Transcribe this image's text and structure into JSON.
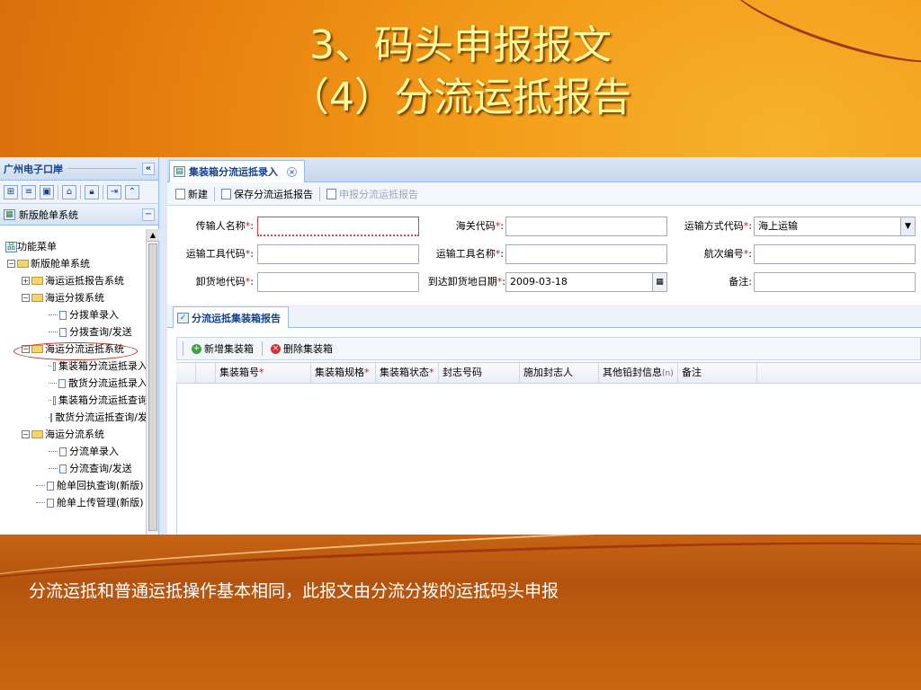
{
  "slide": {
    "title_line1": "3、码头申报报文",
    "title_line2": "（4）分流运抵报告",
    "caption": "分流运抵和普通运抵操作基本相同，此报文由分流分拨的运抵码头申报"
  },
  "sidebar": {
    "header_title": "广州电子口岸",
    "collapse_glyph": "«",
    "panel_title": "新版舱单系统",
    "tree": [
      {
        "label": "功能菜单"
      },
      {
        "label": "新版舱单系统"
      },
      {
        "label": "海运运抵报告系统"
      },
      {
        "label": "海运分拨系统"
      },
      {
        "label": "分拨单录入"
      },
      {
        "label": "分拨查询/发送"
      },
      {
        "label": "海运分流运抵系统"
      },
      {
        "label": "集装箱分流运抵录入"
      },
      {
        "label": "散货分流运抵录入"
      },
      {
        "label": "集装箱分流运抵查询"
      },
      {
        "label": "散货分流运抵查询/发"
      },
      {
        "label": "海运分流系统"
      },
      {
        "label": "分流单录入"
      },
      {
        "label": "分流查询/发送"
      },
      {
        "label": "舱单回执查询(新版)"
      },
      {
        "label": "舱单上传管理(新版)"
      }
    ]
  },
  "main": {
    "tab_title": "集装箱分流运抵录入",
    "toolbar": {
      "new_label": "新建",
      "save_label": "保存分流运抵报告",
      "declare_label": "申报分流运抵报告"
    },
    "form": {
      "sender_name_label": "传输人名称",
      "customs_code_label": "海关代码",
      "transport_mode_label": "运输方式代码",
      "transport_mode_value": "海上运输",
      "vessel_code_label": "运输工具代码",
      "vessel_name_label": "运输工具名称",
      "voyage_no_label": "航次编号",
      "unload_code_label": "卸货地代码",
      "arrival_date_label": "到达卸货地日期",
      "arrival_date_value": "2009-03-18",
      "remark_label": "备注",
      "req_mark": "*",
      "colon": ":"
    },
    "subtab_title": "分流运抵集装箱报告",
    "grid_toolbar": {
      "add_label": "新增集装箱",
      "delete_label": "删除集装箱"
    },
    "grid_columns": [
      "集装箱号",
      "集装箱规格",
      "集装箱状态",
      "封志号码",
      "施加封志人",
      "其他铅封信息",
      "备注"
    ],
    "grid_col_suffix": "(n)"
  }
}
